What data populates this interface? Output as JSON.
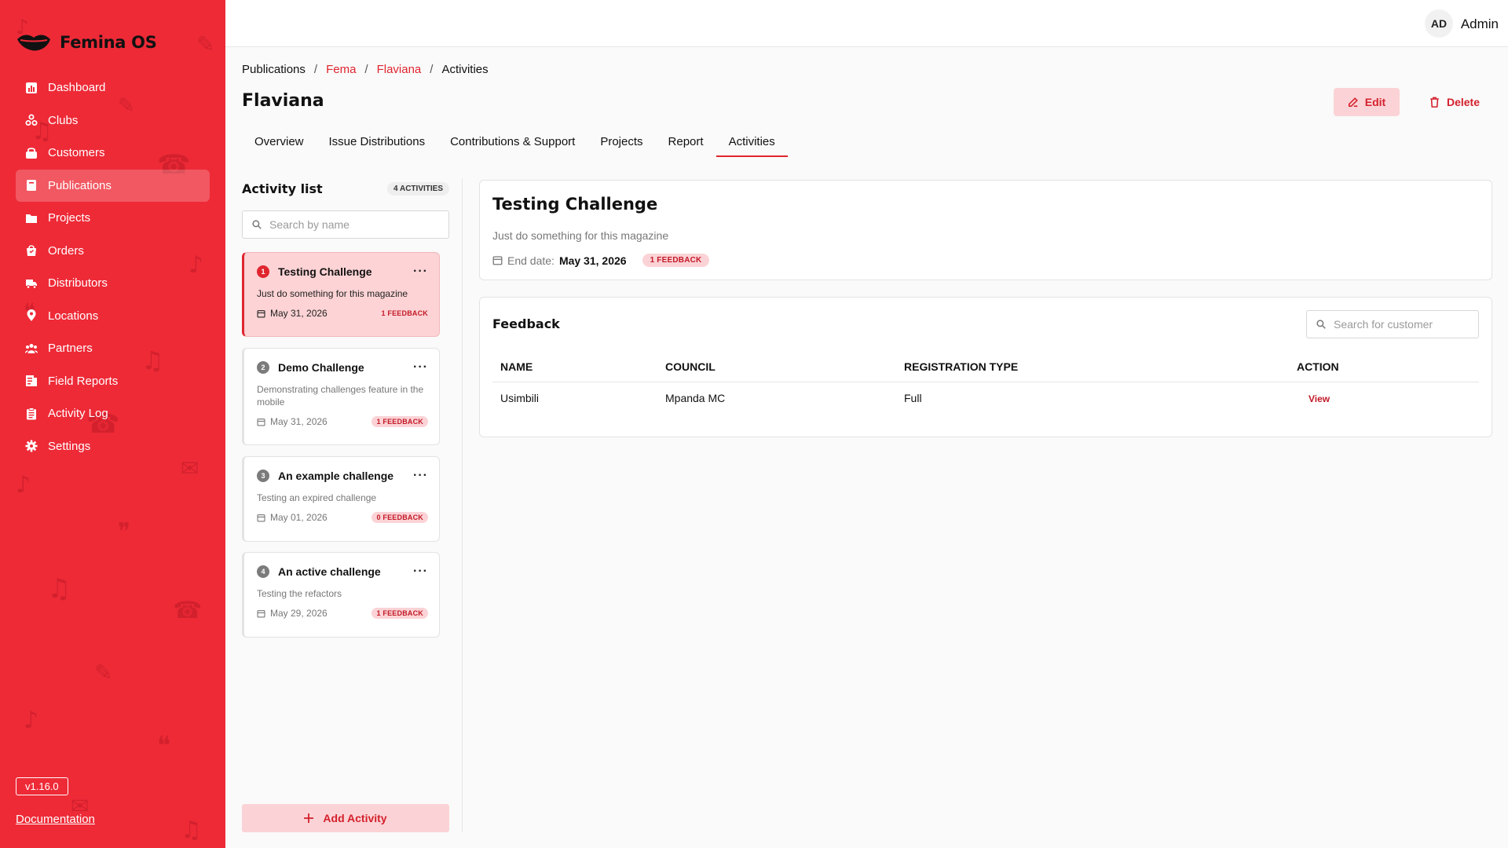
{
  "app": {
    "name": "Femina OS",
    "version": "v1.16.0",
    "doc_link": "Documentation"
  },
  "sidebar": {
    "items": [
      {
        "label": "Dashboard",
        "icon": "chart-icon"
      },
      {
        "label": "Clubs",
        "icon": "clubs-icon"
      },
      {
        "label": "Customers",
        "icon": "customers-icon"
      },
      {
        "label": "Publications",
        "icon": "book-icon",
        "active": true
      },
      {
        "label": "Projects",
        "icon": "folder-icon"
      },
      {
        "label": "Orders",
        "icon": "shopping-bag-icon"
      },
      {
        "label": "Distributors",
        "icon": "truck-icon"
      },
      {
        "label": "Locations",
        "icon": "map-pin-icon"
      },
      {
        "label": "Partners",
        "icon": "people-icon"
      },
      {
        "label": "Field Reports",
        "icon": "report-icon"
      },
      {
        "label": "Activity Log",
        "icon": "clipboard-icon"
      },
      {
        "label": "Settings",
        "icon": "gear-icon"
      }
    ]
  },
  "topbar": {
    "avatar_initials": "AD",
    "user_name": "Admin"
  },
  "breadcrumb": [
    "Publications",
    "Fema",
    "Flaviana",
    "Activities"
  ],
  "page": {
    "title": "Flaviana",
    "edit_label": "Edit",
    "delete_label": "Delete"
  },
  "tabs": [
    "Overview",
    "Issue Distributions",
    "Contributions & Support",
    "Projects",
    "Report",
    "Activities"
  ],
  "activity_list": {
    "title": "Activity list",
    "count_badge": "4 ACTIVITIES",
    "search_placeholder": "Search by name",
    "add_label": "Add Activity",
    "items": [
      {
        "num": "1",
        "title": "Testing Challenge",
        "desc": "Just do something for this magazine",
        "date": "May 31, 2026",
        "feedback": "1 FEEDBACK",
        "active": true
      },
      {
        "num": "2",
        "title": "Demo Challenge",
        "desc": "Demonstrating challenges feature in the mobile",
        "date": "May 31, 2026",
        "feedback": "1 FEEDBACK"
      },
      {
        "num": "3",
        "title": "An example challenge",
        "desc": "Testing an expired challenge",
        "date": "May 01, 2026",
        "feedback": "0 FEEDBACK"
      },
      {
        "num": "4",
        "title": "An active challenge",
        "desc": "Testing the refactors",
        "date": "May 29, 2026",
        "feedback": "1 FEEDBACK"
      }
    ]
  },
  "detail": {
    "title": "Testing Challenge",
    "desc": "Just do something for this magazine",
    "end_label": "End date:",
    "end_date": "May 31, 2026",
    "feedback_badge": "1 FEEDBACK"
  },
  "feedback": {
    "title": "Feedback",
    "search_placeholder": "Search for customer",
    "columns": [
      "NAME",
      "COUNCIL",
      "REGISTRATION TYPE",
      "ACTION"
    ],
    "rows": [
      {
        "name": "Usimbili",
        "council": "Mpanda MC",
        "registration_type": "Full",
        "action": "View"
      }
    ]
  },
  "colors": {
    "brand_red": "#ee2a37",
    "accent": "#e0252f",
    "soft_red": "#fbd3d6"
  }
}
